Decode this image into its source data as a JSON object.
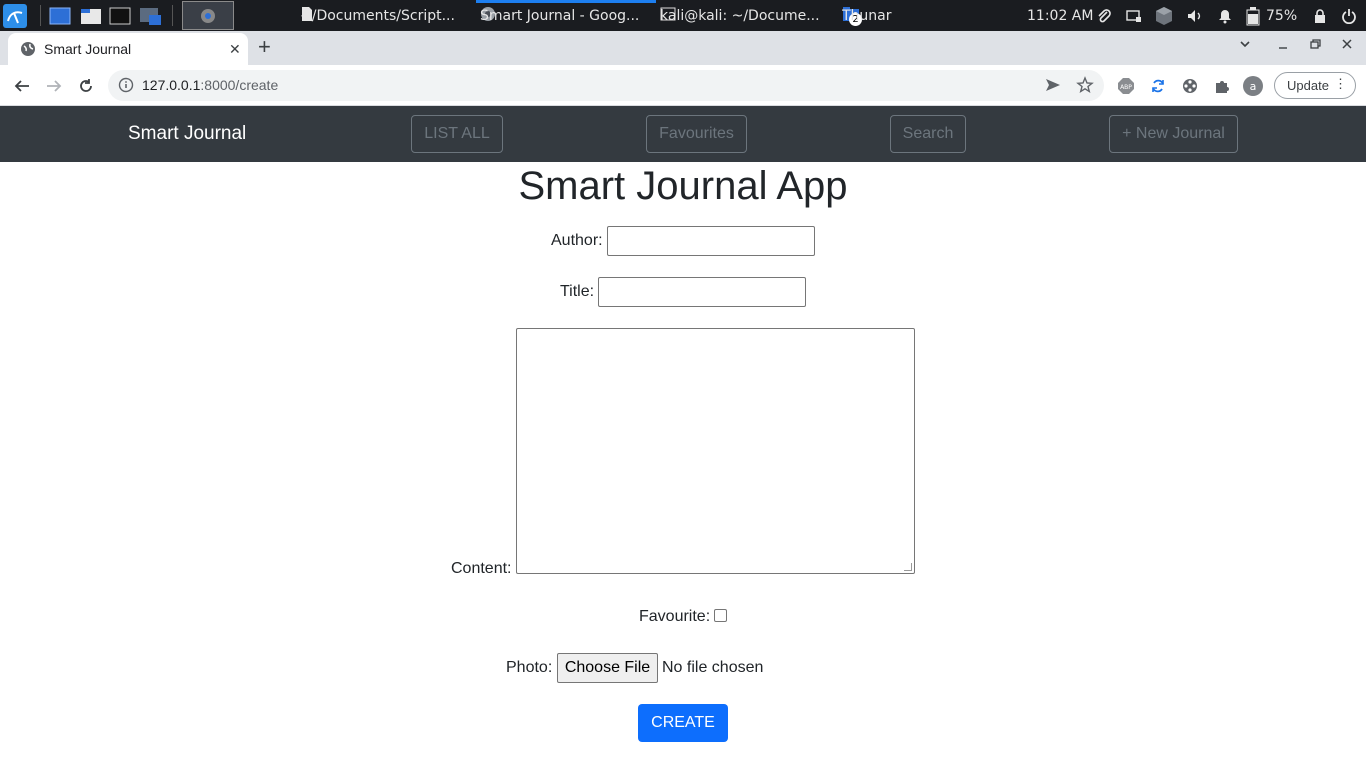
{
  "taskbar": {
    "tasks": [
      {
        "label": "~/Documents/Script...",
        "icon": "document-icon"
      },
      {
        "label": "Smart Journal - Goog...",
        "icon": "chrome-icon"
      },
      {
        "label": "kali@kali: ~/Docume...",
        "icon": "terminal-icon"
      },
      {
        "label": "Thunar",
        "icon": "folder-icon",
        "badge": "2"
      }
    ],
    "clock": "11:02 AM",
    "battery": "75%"
  },
  "browser": {
    "tab_title": "Smart Journal",
    "url_host": "127.0.0.1",
    "url_path": ":8000/create",
    "update_label": "Update"
  },
  "navbar": {
    "brand": "Smart Journal",
    "links": [
      "LIST ALL",
      "Favourites",
      "Search",
      "+ New Journal"
    ]
  },
  "form": {
    "heading": "Smart Journal App",
    "author_label": "Author:",
    "author_value": "",
    "title_label": "Title:",
    "title_value": "",
    "content_label": "Content:",
    "content_value": "",
    "favourite_label": "Favourite:",
    "favourite_checked": false,
    "photo_label": "Photo:",
    "file_button": "Choose File",
    "file_status": "No file chosen",
    "submit": "CREATE"
  },
  "colors": {
    "navbar_bg": "#343a40",
    "nav_link": "#6c757d",
    "primary": "#0d6efd"
  }
}
